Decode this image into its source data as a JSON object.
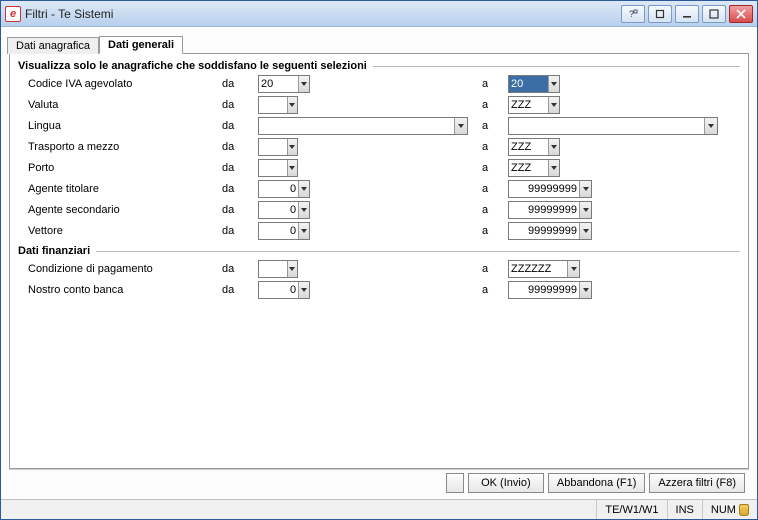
{
  "window": {
    "title": "Filtri - Te Sistemi"
  },
  "tabs": {
    "anagrafica": "Dati anagrafica",
    "generali": "Dati generali"
  },
  "section1": {
    "legend": "Visualizza solo le anagrafiche che soddisfano le seguenti selezioni",
    "da": "da",
    "a": "a",
    "rows": {
      "codice_iva": {
        "label": "Codice IVA agevolato",
        "from": "20",
        "to": "20"
      },
      "valuta": {
        "label": "Valuta",
        "from": "",
        "to": "ZZZ"
      },
      "lingua": {
        "label": "Lingua",
        "from": "",
        "to": ""
      },
      "trasporto": {
        "label": "Trasporto a mezzo",
        "from": "",
        "to": "ZZZ"
      },
      "porto": {
        "label": "Porto",
        "from": "",
        "to": "ZZZ"
      },
      "agente_tit": {
        "label": "Agente titolare",
        "from": "0",
        "to": "99999999"
      },
      "agente_sec": {
        "label": "Agente secondario",
        "from": "0",
        "to": "99999999"
      },
      "vettore": {
        "label": "Vettore",
        "from": "0",
        "to": "99999999"
      }
    }
  },
  "section2": {
    "legend": "Dati finanziari",
    "da": "da",
    "a": "a",
    "rows": {
      "cond_pag": {
        "label": "Condizione di pagamento",
        "from": "",
        "to": "ZZZZZZ"
      },
      "conto_banca": {
        "label": "Nostro conto banca",
        "from": "0",
        "to": "99999999"
      }
    }
  },
  "buttons": {
    "ok": "OK (Invio)",
    "abbandona": "Abbandona (F1)",
    "azzera": "Azzera filtri (F8)"
  },
  "status": {
    "path": "TE/W1/W1",
    "ins": "INS",
    "num": "NUM"
  }
}
